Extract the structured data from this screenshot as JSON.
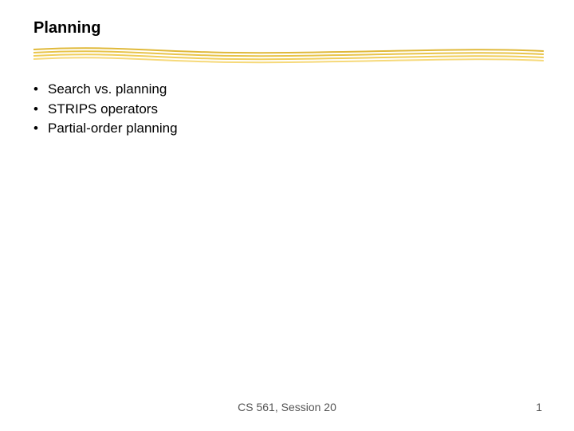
{
  "title": "Planning",
  "bullets": [
    "Search vs. planning",
    "STRIPS operators",
    "Partial-order planning"
  ],
  "footer": {
    "center": "CS 561, Session 20",
    "page": "1"
  }
}
